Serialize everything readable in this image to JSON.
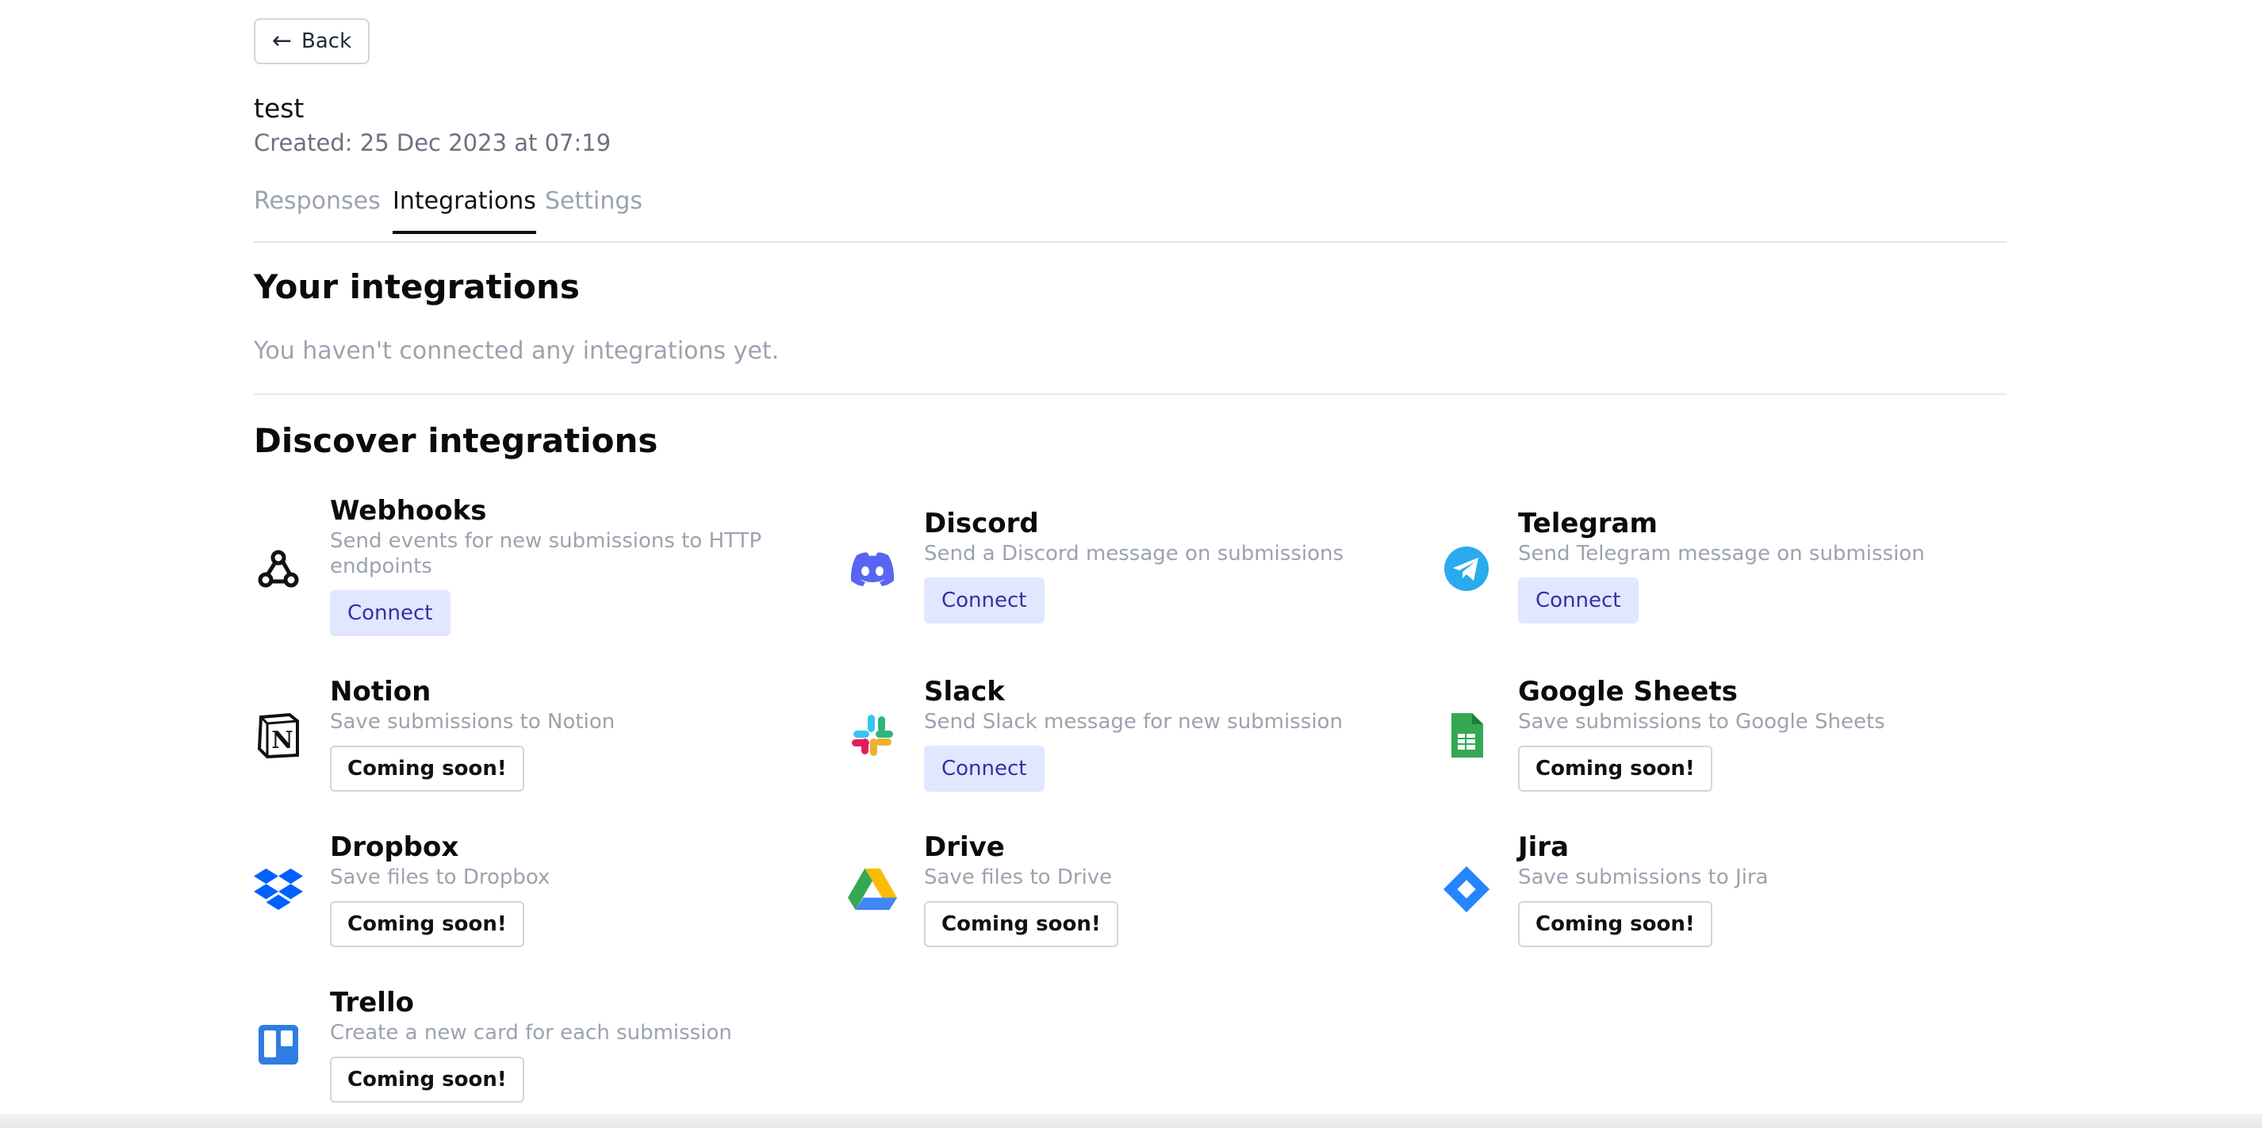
{
  "back": {
    "label": "Back"
  },
  "form": {
    "title": "test",
    "created": "Created: 25 Dec 2023 at 07:19"
  },
  "tabs": [
    {
      "label": "Responses"
    },
    {
      "label": "Integrations"
    },
    {
      "label": "Settings"
    }
  ],
  "your_integrations": {
    "heading": "Your integrations",
    "empty_text": "You haven't connected any integrations yet."
  },
  "discover": {
    "heading": "Discover integrations"
  },
  "integrations": [
    {
      "name": "Webhooks",
      "desc": "Send events for new submissions to HTTP endpoints",
      "action": "Connect",
      "icon": "webhook-icon"
    },
    {
      "name": "Discord",
      "desc": "Send a Discord message on submissions",
      "action": "Connect",
      "icon": "discord-icon"
    },
    {
      "name": "Telegram",
      "desc": "Send Telegram message on submission",
      "action": "Connect",
      "icon": "telegram-icon"
    },
    {
      "name": "Notion",
      "desc": "Save submissions to Notion",
      "action": "Coming soon!",
      "icon": "notion-icon"
    },
    {
      "name": "Slack",
      "desc": "Send Slack message for new submission",
      "action": "Connect",
      "icon": "slack-icon"
    },
    {
      "name": "Google Sheets",
      "desc": "Save submissions to Google Sheets",
      "action": "Coming soon!",
      "icon": "google-sheets-icon"
    },
    {
      "name": "Dropbox",
      "desc": "Save files to Dropbox",
      "action": "Coming soon!",
      "icon": "dropbox-icon"
    },
    {
      "name": "Drive",
      "desc": "Save files to Drive",
      "action": "Coming soon!",
      "icon": "google-drive-icon"
    },
    {
      "name": "Jira",
      "desc": "Save submissions to Jira",
      "action": "Coming soon!",
      "icon": "jira-icon"
    },
    {
      "name": "Trello",
      "desc": "Create a new card for each submission",
      "action": "Coming soon!",
      "icon": "trello-icon"
    }
  ],
  "colors": {
    "connect_bg": "#e0e7ff",
    "connect_text": "#3730a3",
    "muted_text": "#9ca3af",
    "active_tab": "#111111"
  }
}
